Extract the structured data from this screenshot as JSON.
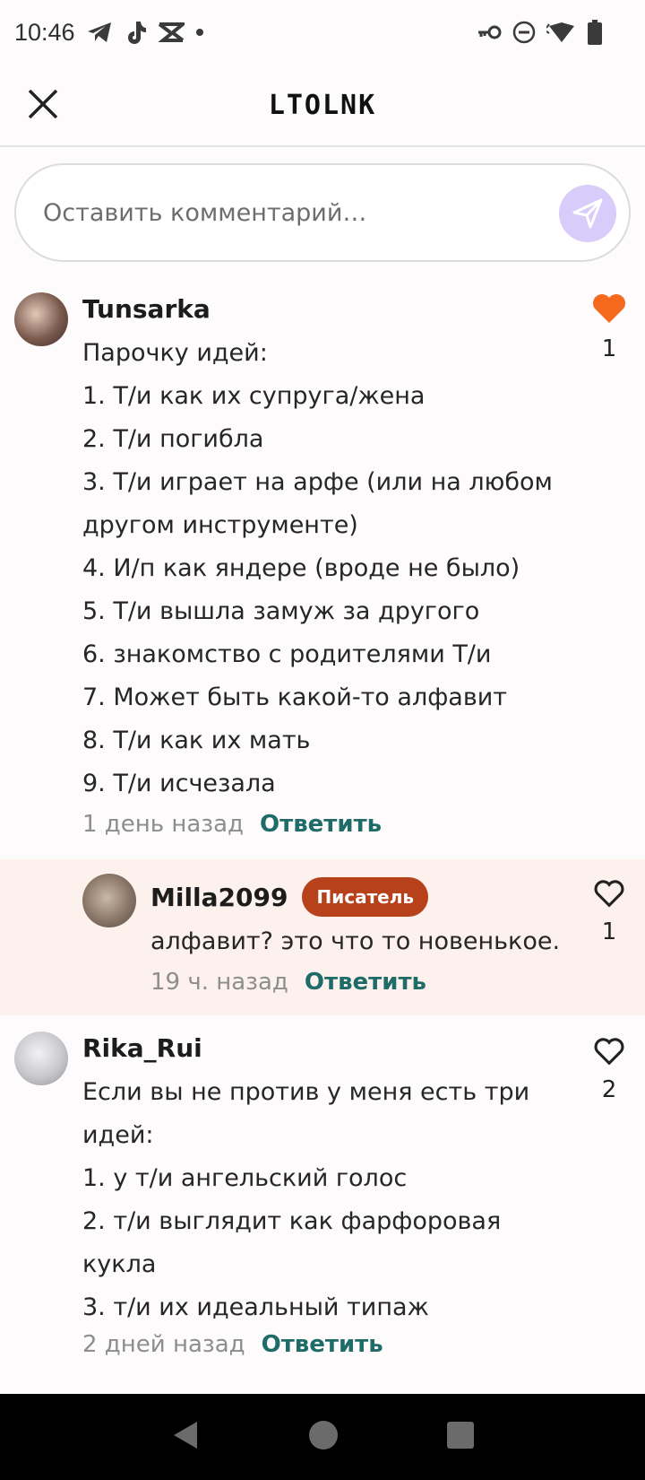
{
  "status": {
    "time": "10:46"
  },
  "header": {
    "title": "ᏓᎢᏅᏂᏁᏦ",
    "display_title": "LTOLNK"
  },
  "comment_input": {
    "placeholder": "Оставить комментарий…"
  },
  "comments": [
    {
      "author": "Tunsarka",
      "lines": [
        "Парочку идей:",
        "1. Т/и как их супруга/жена",
        "2. Т/и погибла",
        "3. Т/и играет на арфе (или на любом",
        "другом инструменте)",
        "4. И/п как яндере (вроде не было)",
        "5. Т/и вышла замуж за другого",
        "6. знакомство с родителями Т/и",
        "7. Может быть какой-то алфавит",
        "8. Т/и как их мать",
        "9. Т/и исчезала"
      ],
      "time": "1 день назад",
      "reply_label": "Ответить",
      "likes": "1",
      "liked": true
    },
    {
      "author": "Milla2099",
      "badge": "Писатель",
      "lines": [
        "алфавит? это что то новенькое."
      ],
      "time": "19 ч. назад",
      "reply_label": "Ответить",
      "likes": "1",
      "liked": false
    },
    {
      "author": "Rika_Rui",
      "lines": [
        "Если вы не против у меня есть три",
        "идей:",
        "1. у т/и ангельский голос",
        "2. т/и выглядит как фарфоровая",
        "кукла",
        "3. т/и их идеальный типаж"
      ],
      "time": "2 дней назад",
      "reply_label": "Ответить",
      "likes": "2",
      "liked": false
    }
  ],
  "colors": {
    "accent_like": "#f4691e",
    "reply_link": "#1f6b68",
    "badge": "#b6411b",
    "send_button": "#d8cdfa"
  },
  "icons": [
    "telegram-icon",
    "tiktok-icon",
    "capcut-icon",
    "key-icon",
    "dnd-icon",
    "wifi-icon",
    "battery-icon",
    "close-icon",
    "send-icon",
    "heart-icon",
    "back-icon",
    "home-icon",
    "recents-icon"
  ]
}
